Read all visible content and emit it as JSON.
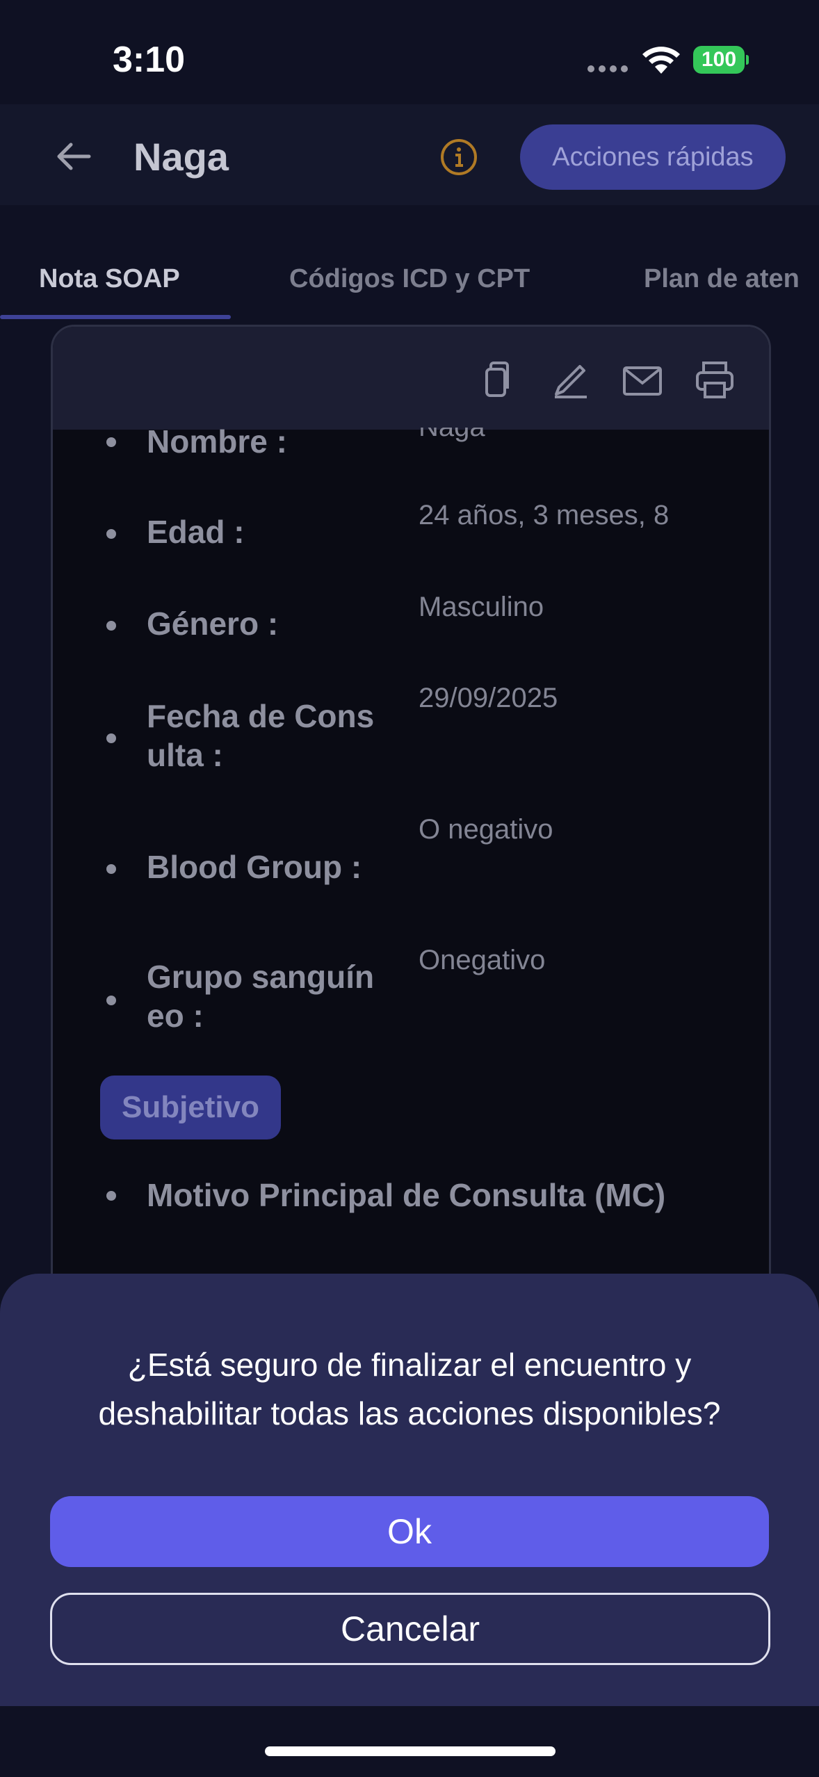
{
  "status_bar": {
    "time": "3:10",
    "battery": "100"
  },
  "header": {
    "title": "Naga",
    "quick_actions": "Acciones rápidas"
  },
  "tabs": [
    {
      "label": "Nota SOAP"
    },
    {
      "label": "Códigos ICD y CPT"
    },
    {
      "label": "Plan de aten"
    }
  ],
  "patient": [
    {
      "label": "Nombre :",
      "value": "Naga"
    },
    {
      "label": "Edad :",
      "value": "24 años, 3 meses, 8"
    },
    {
      "label": "Género :",
      "value": "Masculino"
    },
    {
      "label": "Fecha de Cons ulta :",
      "value": "29/09/2025"
    },
    {
      "label": "Blood Group :",
      "value": "O negativo"
    },
    {
      "label": "Grupo sanguín eo :",
      "value": "Onegativo"
    }
  ],
  "section_badge": "Subjetivo",
  "subjective_item": "Motivo Principal de Consulta (MC)",
  "dialog": {
    "message": "¿Está seguro de finalizar el encuentro y deshabilitar todas las acciones disponibles?",
    "ok": "Ok",
    "cancel": "Cancelar"
  },
  "icons": [
    "back-arrow-icon",
    "info-icon",
    "copy-icon",
    "edit-pencil-icon",
    "mail-icon",
    "print-icon",
    "wifi-icon",
    "battery-icon"
  ],
  "colors": {
    "accent": "#5f5de9",
    "sheet": "#292b55",
    "background": "#0f1123"
  }
}
